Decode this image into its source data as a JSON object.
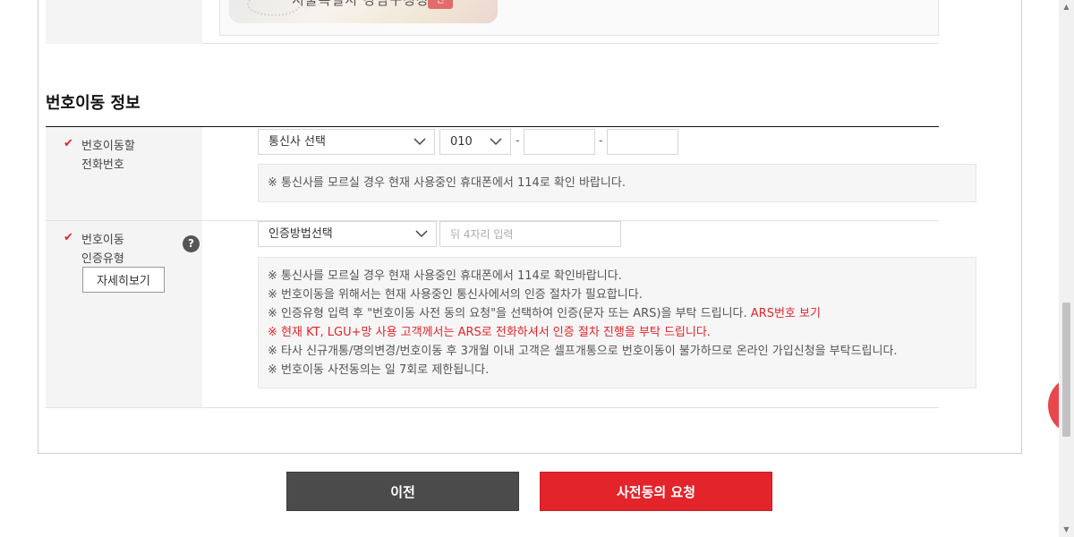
{
  "id_card": {
    "issuer": "서울특별시 강남구청장",
    "seal": "인"
  },
  "section": {
    "title": "번호이동 정보"
  },
  "phone_row": {
    "required_mark": "✔",
    "label_line1": "번호이동할",
    "label_line2": "전화번호",
    "carrier_select": "통신사 선택",
    "prefix_select": "010",
    "dash": "-",
    "middle_value": "",
    "last_value": "",
    "notice": "※ 통신사를 모르실 경우 현재 사용중인 휴대폰에서 114로 확인 바랍니다."
  },
  "auth_row": {
    "required_mark": "✔",
    "label_line1": "번호이동",
    "label_line2": "인증유형",
    "help_icon": "?",
    "detail_button": "자세히보기",
    "method_select": "인증방법선택",
    "last4_placeholder": "뒤 4자리 입력",
    "notices": [
      "※ 통신사를 모르실 경우 현재 사용중인 휴대폰에서 114로 확인바랍니다.",
      "※ 번호이동을 위해서는 현재 사용중인 통신사에서의 인증 절차가 필요합니다.",
      "※ 인증유형 입력 후 \"번호이동 사전 동의 요청\"을 선택하여 인증(문자 또는 ARS)을 부탁 드립니다.",
      "ARS번호 보기",
      "※ 현재 KT, LGU+망 사용 고객께서는 ARS로 전화하셔서 인증 절차 진행을 부탁 드립니다.",
      "※ 타사 신규개통/명의변경/번호이동 후 3개월 이내 고객은 셀프개통으로 번호이동이 불가하므로 온라인 가입신청을 부탁드립니다.",
      "※ 번호이동 사전동의는 일 7회로 제한됩니다."
    ]
  },
  "buttons": {
    "prev": "이전",
    "request": "사전동의 요청"
  },
  "colors": {
    "accent_red": "#e3242b",
    "dark_button": "#4b4b4b",
    "header_bg": "#f4f4f4"
  },
  "icons": {
    "check": "check-icon",
    "help": "question-circle-icon",
    "chevron": "chevron-down-icon"
  }
}
